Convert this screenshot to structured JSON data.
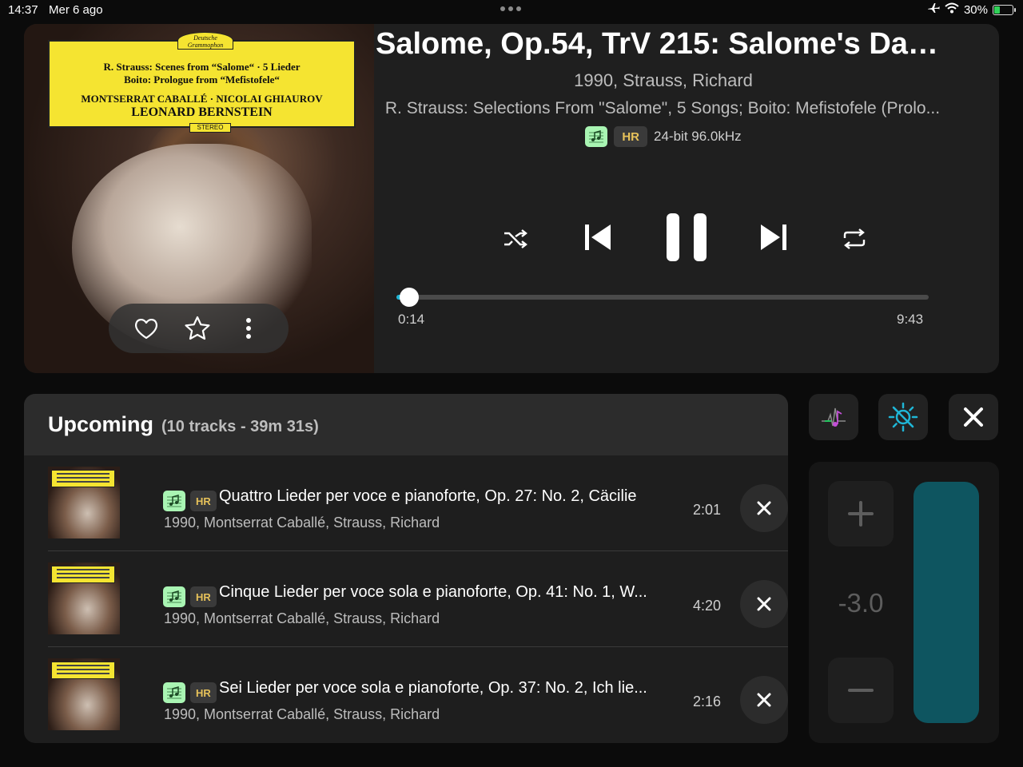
{
  "status_bar": {
    "time": "14:37",
    "date": "Mer 6 ago",
    "battery": "30%"
  },
  "now_playing": {
    "title": "Salome, Op.54, TrV 215: Salome's Dan...",
    "subtitle": "1990, Strauss, Richard",
    "album": "R. Strauss: Selections From \"Salome\", 5 Songs; Boito: Mefistofele (Prolo...",
    "badge_hr": "HR",
    "format": "24-bit 96.0kHz",
    "elapsed": "0:14",
    "duration": "9:43",
    "progress_fraction": 0.024
  },
  "cover_art": {
    "label_lines": [
      "R. Strauss: Scenes from “Salome“ · 5 Lieder",
      "Boito: Prologue from “Mefistofele“",
      "MONTSERRAT CABALLÉ · NICOLAI GHIAUROV",
      "LEONARD BERNSTEIN"
    ],
    "logo": "Deutsche Grammophon",
    "stereo": "STEREO"
  },
  "queue": {
    "title": "Upcoming",
    "meta": "(10 tracks - 39m 31s)",
    "items": [
      {
        "badge": "HR",
        "title": "Quattro Lieder per voce e pianoforte, Op. 27: No. 2, Cäcilie",
        "subtitle": "1990, Montserrat Caballé, Strauss, Richard",
        "duration": "2:01"
      },
      {
        "badge": "HR",
        "title": "Cinque Lieder per voce sola e pianoforte, Op. 41: No. 1, W...",
        "subtitle": "1990, Montserrat Caballé, Strauss, Richard",
        "duration": "4:20"
      },
      {
        "badge": "HR",
        "title": "Sei Lieder per voce sola e pianoforte, Op. 37: No. 2, Ich lie...",
        "subtitle": "1990, Montserrat Caballé, Strauss, Richard",
        "duration": "2:16"
      }
    ]
  },
  "volume": {
    "level": "-3.0",
    "fill_fraction": 1.0
  },
  "colors": {
    "accent": "#1fb6d6",
    "hifi_badge": "#a9f5b3",
    "hr_text": "#e7c25a",
    "volume_bar": "#0e5560"
  },
  "icons": [
    "airplane-icon",
    "wifi-icon",
    "heart-icon",
    "star-icon",
    "more-icon",
    "shuffle-icon",
    "previous-icon",
    "pause-icon",
    "next-icon",
    "repeat-icon",
    "close-icon",
    "eq-icon",
    "brightness-icon",
    "plus-icon",
    "minus-icon"
  ]
}
